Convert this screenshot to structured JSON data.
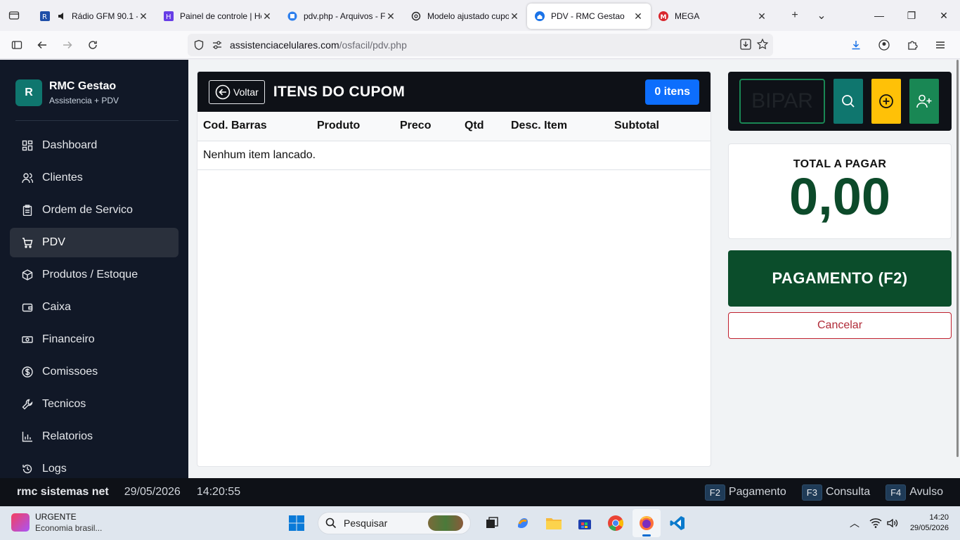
{
  "browser": {
    "tabs": [
      {
        "title": "Rádio GFM 90.1 - ",
        "active": false
      },
      {
        "title": "Painel de controle | Ho",
        "active": false
      },
      {
        "title": "pdv.php - Arquivos - Fi",
        "active": false
      },
      {
        "title": "Modelo ajustado cupo",
        "active": false
      },
      {
        "title": "PDV - RMC Gestao",
        "active": true
      },
      {
        "title": "MEGA",
        "active": false
      }
    ],
    "url_host": "assistenciacelulares.com",
    "url_path": "/osfacil/pdv.php"
  },
  "sidebar": {
    "brand_initial": "R",
    "brand_name": "RMC Gestao",
    "brand_sub": "Assistencia + PDV",
    "items": [
      {
        "label": "Dashboard",
        "icon": "dashboard-icon",
        "active": false
      },
      {
        "label": "Clientes",
        "icon": "users-icon",
        "active": false
      },
      {
        "label": "Ordem de Servico",
        "icon": "clipboard-icon",
        "active": false
      },
      {
        "label": "PDV",
        "icon": "cart-icon",
        "active": true
      },
      {
        "label": "Produtos / Estoque",
        "icon": "box-icon",
        "active": false
      },
      {
        "label": "Caixa",
        "icon": "wallet-icon",
        "active": false
      },
      {
        "label": "Financeiro",
        "icon": "cash-icon",
        "active": false
      },
      {
        "label": "Comissoes",
        "icon": "dollar-icon",
        "active": false
      },
      {
        "label": "Tecnicos",
        "icon": "wrench-icon",
        "active": false
      },
      {
        "label": "Relatorios",
        "icon": "chart-icon",
        "active": false
      },
      {
        "label": "Logs",
        "icon": "history-icon",
        "active": false
      }
    ]
  },
  "cupom": {
    "back_label": "Voltar",
    "title": "ITENS DO CUPOM",
    "count_badge": "0 itens",
    "columns": [
      "Cod. Barras",
      "Produto",
      "Preco",
      "Qtd",
      "Desc. Item",
      "Subtotal"
    ],
    "empty_message": "Nenhum item lancado."
  },
  "scan": {
    "placeholder": "BIPAR"
  },
  "total": {
    "label": "TOTAL A PAGAR",
    "value": "0,00"
  },
  "actions": {
    "payment_label": "PAGAMENTO (F2)",
    "cancel_label": "Cancelar"
  },
  "footer": {
    "brand": "rmc sistemas net",
    "date": "29/05/2026",
    "time": "14:20:55",
    "shortcuts": [
      {
        "key": "F2",
        "label": "Pagamento"
      },
      {
        "key": "F3",
        "label": "Consulta"
      },
      {
        "key": "F4",
        "label": "Avulso"
      }
    ]
  },
  "taskbar": {
    "news_title": "URGENTE",
    "news_sub": "Economia brasil...",
    "search_placeholder": "Pesquisar",
    "clock_time": "14:20",
    "clock_date": "29/05/2026"
  },
  "colors": {
    "sidebar_bg": "#111827",
    "brand_green": "#0f766e",
    "badge_blue": "#0d6efd",
    "payment_green": "#0b4d2b",
    "total_green": "#0c4a2a",
    "cancel_red": "#b02a37",
    "scan_search": "#0f766e",
    "scan_add": "#ffc107",
    "scan_user": "#198754"
  }
}
